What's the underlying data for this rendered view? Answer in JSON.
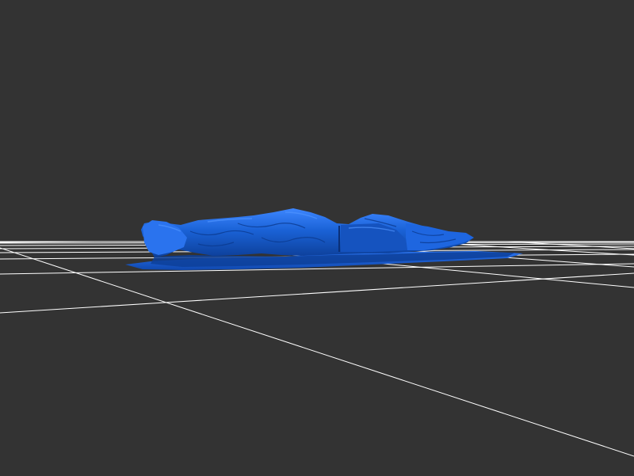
{
  "scene": {
    "background_color": "#333333",
    "grid_color": "#ffffff",
    "mesh_color": "#1a62d6",
    "mesh_shadow_color": "#0d3f99",
    "mesh_highlight_color": "#3d86ff",
    "grid_visible": true,
    "object_description_icon": "3d-mesh-model"
  }
}
